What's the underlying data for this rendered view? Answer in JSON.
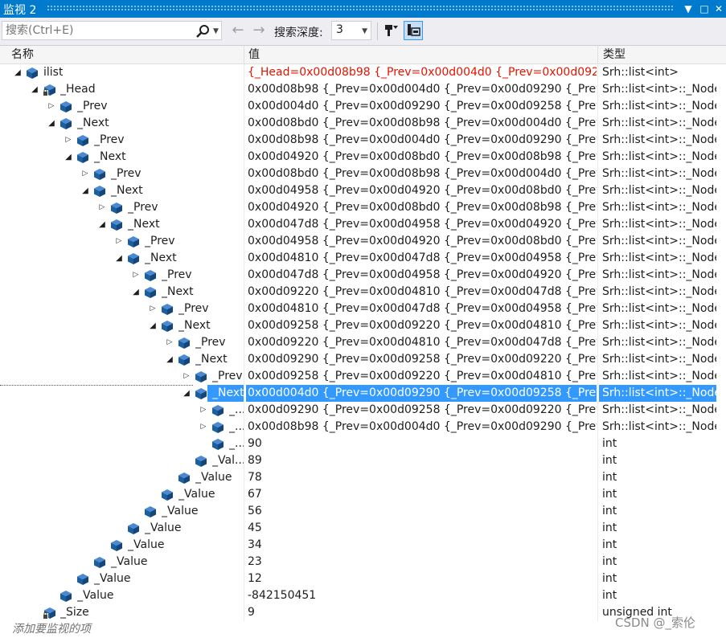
{
  "window": {
    "title": "监视 2",
    "btn_dropdown": "▼",
    "btn_maximize": "□",
    "btn_close": "✕"
  },
  "toolbar": {
    "search_placeholder": "搜索(Ctrl+E)",
    "depth_label": "搜索深度:",
    "depth_value": "3"
  },
  "columns": {
    "name": "名称",
    "value": "值",
    "type": "类型"
  },
  "rows": [
    {
      "indent": 0,
      "icon": "var",
      "exp": "down",
      "name": "ilist",
      "value": "{_Head=0x00d08b98 {_Prev=0x00d004d0 {_Prev=0x00d09290 {_...",
      "type": "Srh::list<int>",
      "changed": true
    },
    {
      "indent": 1,
      "icon": "private",
      "exp": "down",
      "name": "_Head",
      "value": "0x00d08b98 {_Prev=0x00d004d0 {_Prev=0x00d09290 {_Prev=0x0...",
      "type": "Srh::list<int>::_Node *"
    },
    {
      "indent": 2,
      "icon": "member",
      "exp": "right",
      "name": "_Prev",
      "value": "0x00d004d0 {_Prev=0x00d09290 {_Prev=0x00d09258 {_Prev=0x0...",
      "type": "Srh::list<int>::_Node *"
    },
    {
      "indent": 2,
      "icon": "member",
      "exp": "down",
      "name": "_Next",
      "value": "0x00d08bd0 {_Prev=0x00d08b98 {_Prev=0x00d004d0 {_Prev=0x0...",
      "type": "Srh::list<int>::_Node *"
    },
    {
      "indent": 3,
      "icon": "member",
      "exp": "right",
      "name": "_Prev",
      "value": "0x00d08b98 {_Prev=0x00d004d0 {_Prev=0x00d09290 {_Prev=0x0...",
      "type": "Srh::list<int>::_Node *"
    },
    {
      "indent": 3,
      "icon": "member",
      "exp": "down",
      "name": "_Next",
      "value": "0x00d04920 {_Prev=0x00d08bd0 {_Prev=0x00d08b98 {_Prev=0x0...",
      "type": "Srh::list<int>::_Node *"
    },
    {
      "indent": 4,
      "icon": "member",
      "exp": "right",
      "name": "_Prev",
      "value": "0x00d08bd0 {_Prev=0x00d08b98 {_Prev=0x00d004d0 {_Prev=0x0...",
      "type": "Srh::list<int>::_Node *"
    },
    {
      "indent": 4,
      "icon": "member",
      "exp": "down",
      "name": "_Next",
      "value": "0x00d04958 {_Prev=0x00d04920 {_Prev=0x00d08bd0 {_Prev=0x0...",
      "type": "Srh::list<int>::_Node *"
    },
    {
      "indent": 5,
      "icon": "member",
      "exp": "right",
      "name": "_Prev",
      "value": "0x00d04920 {_Prev=0x00d08bd0 {_Prev=0x00d08b98 {_Prev=0x0...",
      "type": "Srh::list<int>::_Node *"
    },
    {
      "indent": 5,
      "icon": "member",
      "exp": "down",
      "name": "_Next",
      "value": "0x00d047d8 {_Prev=0x00d04958 {_Prev=0x00d04920 {_Prev=0x0...",
      "type": "Srh::list<int>::_Node *"
    },
    {
      "indent": 6,
      "icon": "member",
      "exp": "right",
      "name": "_Prev",
      "value": "0x00d04958 {_Prev=0x00d04920 {_Prev=0x00d08bd0 {_Prev=0x0...",
      "type": "Srh::list<int>::_Node *"
    },
    {
      "indent": 6,
      "icon": "member",
      "exp": "down",
      "name": "_Next",
      "value": "0x00d04810 {_Prev=0x00d047d8 {_Prev=0x00d04958 {_Prev=0x0...",
      "type": "Srh::list<int>::_Node *"
    },
    {
      "indent": 7,
      "icon": "member",
      "exp": "right",
      "name": "_Prev",
      "value": "0x00d047d8 {_Prev=0x00d04958 {_Prev=0x00d04920 {_Prev=0x0...",
      "type": "Srh::list<int>::_Node *"
    },
    {
      "indent": 7,
      "icon": "member",
      "exp": "down",
      "name": "_Next",
      "value": "0x00d09220 {_Prev=0x00d04810 {_Prev=0x00d047d8 {_Prev=0x0...",
      "type": "Srh::list<int>::_Node *"
    },
    {
      "indent": 8,
      "icon": "member",
      "exp": "right",
      "name": "_Prev",
      "value": "0x00d04810 {_Prev=0x00d047d8 {_Prev=0x00d04958 {_Prev=0x0...",
      "type": "Srh::list<int>::_Node *"
    },
    {
      "indent": 8,
      "icon": "member",
      "exp": "down",
      "name": "_Next",
      "value": "0x00d09258 {_Prev=0x00d09220 {_Prev=0x00d04810 {_Prev=0x0...",
      "type": "Srh::list<int>::_Node *"
    },
    {
      "indent": 9,
      "icon": "member",
      "exp": "right",
      "name": "_Prev",
      "value": "0x00d09220 {_Prev=0x00d04810 {_Prev=0x00d047d8 {_Prev=0x0...",
      "type": "Srh::list<int>::_Node *"
    },
    {
      "indent": 9,
      "icon": "member",
      "exp": "down",
      "name": "_Next",
      "value": "0x00d09290 {_Prev=0x00d09258 {_Prev=0x00d09220 {_Prev=0x0...",
      "type": "Srh::list<int>::_Node *"
    },
    {
      "indent": 10,
      "icon": "member",
      "exp": "right",
      "name": "_Prev",
      "value": "0x00d09258 {_Prev=0x00d09220 {_Prev=0x00d04810 {_Prev=0x0...",
      "type": "Srh::list<int>::_Node *"
    },
    {
      "indent": 10,
      "icon": "member",
      "exp": "down",
      "name": "_Next",
      "value": "0x00d004d0 {_Prev=0x00d09290 {_Prev=0x00d09258 {_Prev=0x0...",
      "type": "Srh::list<int>::_Node *",
      "selected": true
    },
    {
      "indent": 11,
      "icon": "member",
      "exp": "right",
      "name": "_...",
      "value": "0x00d09290 {_Prev=0x00d09258 {_Prev=0x00d09220 {_Prev=0x0...",
      "type": "Srh::list<int>::_Node *"
    },
    {
      "indent": 11,
      "icon": "member",
      "exp": "right",
      "name": "_...",
      "value": "0x00d08b98 {_Prev=0x00d004d0 {_Prev=0x00d09290 {_Prev=0x0...",
      "type": "Srh::list<int>::_Node *"
    },
    {
      "indent": 11,
      "icon": "member",
      "exp": "none",
      "name": "_...",
      "value": "90",
      "type": "int"
    },
    {
      "indent": 10,
      "icon": "member",
      "exp": "none",
      "name": "_Val...",
      "value": "89",
      "type": "int"
    },
    {
      "indent": 9,
      "icon": "member",
      "exp": "none",
      "name": "_Value",
      "value": "78",
      "type": "int"
    },
    {
      "indent": 8,
      "icon": "member",
      "exp": "none",
      "name": "_Value",
      "value": "67",
      "type": "int"
    },
    {
      "indent": 7,
      "icon": "member",
      "exp": "none",
      "name": "_Value",
      "value": "56",
      "type": "int"
    },
    {
      "indent": 6,
      "icon": "member",
      "exp": "none",
      "name": "_Value",
      "value": "45",
      "type": "int"
    },
    {
      "indent": 5,
      "icon": "member",
      "exp": "none",
      "name": "_Value",
      "value": "34",
      "type": "int"
    },
    {
      "indent": 4,
      "icon": "member",
      "exp": "none",
      "name": "_Value",
      "value": "23",
      "type": "int"
    },
    {
      "indent": 3,
      "icon": "member",
      "exp": "none",
      "name": "_Value",
      "value": "12",
      "type": "int"
    },
    {
      "indent": 2,
      "icon": "member",
      "exp": "none",
      "name": "_Value",
      "value": "-842150451",
      "type": "int"
    },
    {
      "indent": 1,
      "icon": "private",
      "exp": "none",
      "name": "_Size",
      "value": "9",
      "type": "unsigned int"
    }
  ],
  "add_watch": "添加要监视的项",
  "watermark": "CSDN @_索伦",
  "colors": {
    "accent": "#007acc",
    "selection": "#3399ff",
    "changed": "#e51400",
    "icon": "#1c5f9e"
  }
}
